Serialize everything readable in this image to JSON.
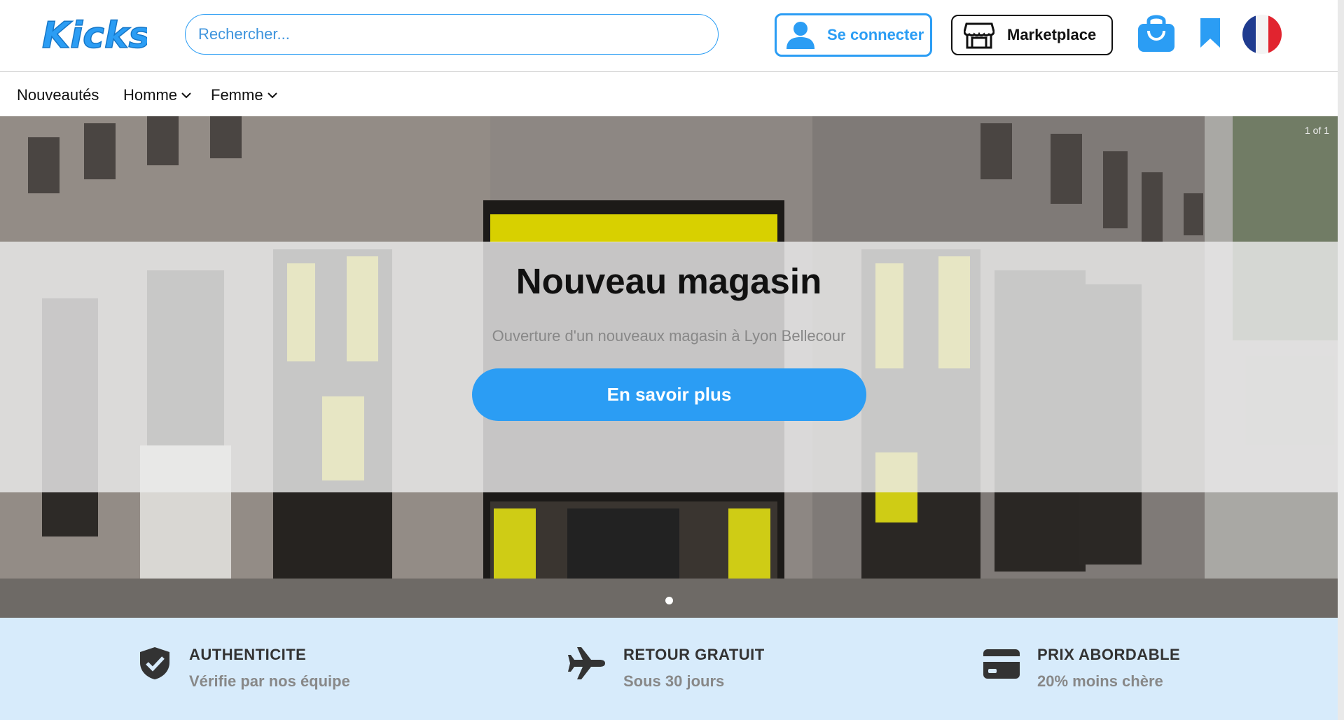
{
  "brand": {
    "logo_text": "Kicks",
    "accent_color": "#2b9df4"
  },
  "header": {
    "search_placeholder": "Rechercher...",
    "login_label": "Se connecter",
    "marketplace_label": "Marketplace",
    "icons": [
      "user-icon",
      "store-icon",
      "shopping-bag-icon",
      "bookmark-icon",
      "france-flag-icon"
    ]
  },
  "nav": {
    "items": [
      {
        "label": "Nouveautés",
        "has_dropdown": false
      },
      {
        "label": "Homme",
        "has_dropdown": true
      },
      {
        "label": "Femme",
        "has_dropdown": true
      }
    ]
  },
  "hero": {
    "counter": "1 of 1",
    "title": "Nouveau magasin",
    "subtitle": "Ouverture d'un nouveaux magasin à Lyon Bellecour",
    "cta_label": "En savoir plus",
    "slide_count": 1,
    "active_slide": 1
  },
  "features": [
    {
      "icon": "shield-check-icon",
      "title": "AUTHENTICITE",
      "subtitle": "Vérifie par nos équipe"
    },
    {
      "icon": "airplane-icon",
      "title": "RETOUR GRATUIT",
      "subtitle": "Sous 30 jours"
    },
    {
      "icon": "credit-card-icon",
      "title": "PRIX ABORDABLE",
      "subtitle": "20% moins chère"
    }
  ]
}
